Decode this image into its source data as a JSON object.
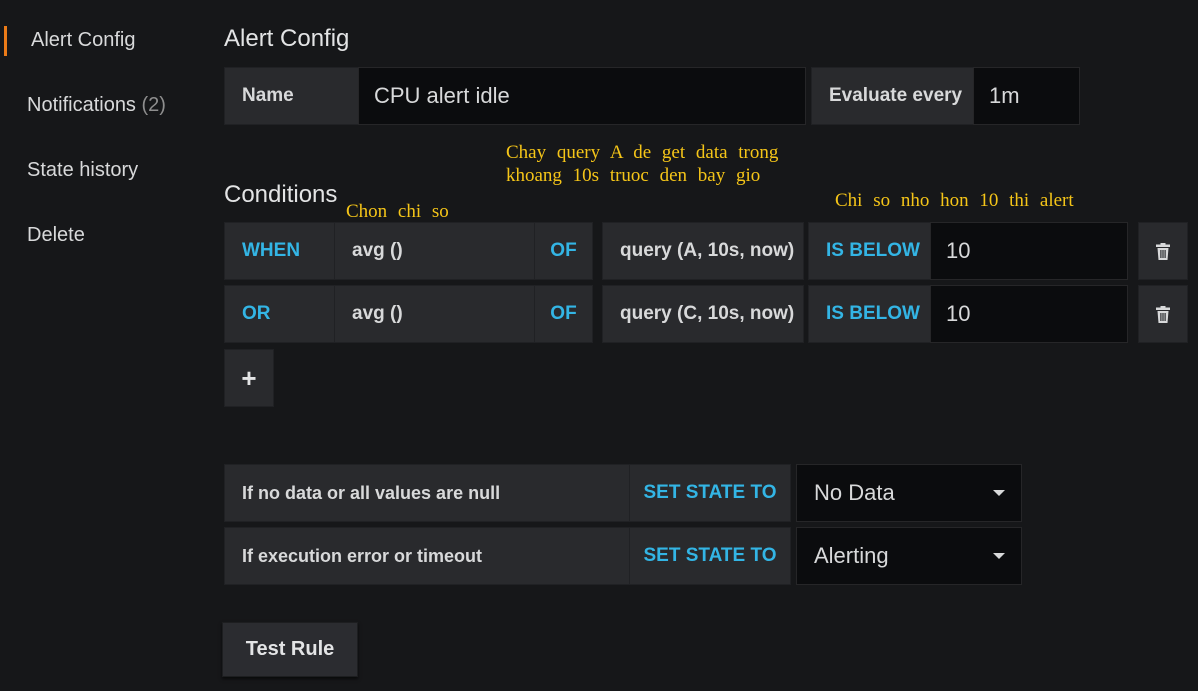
{
  "sidebar": {
    "items": [
      {
        "label": "Alert Config"
      },
      {
        "label": "Notifications",
        "count": "(2)"
      },
      {
        "label": "State history"
      },
      {
        "label": "Delete"
      }
    ]
  },
  "alert_config": {
    "title": "Alert Config",
    "name_label": "Name",
    "name_value": "CPU alert idle",
    "evaluate_label": "Evaluate every",
    "evaluate_value": "1m"
  },
  "conditions": {
    "title": "Conditions",
    "rows": [
      {
        "operator": "WHEN",
        "reducer": "avg ()",
        "of": "OF",
        "query": "query (A, 10s, now)",
        "evaluator": "IS BELOW",
        "threshold": "10"
      },
      {
        "operator": "OR",
        "reducer": "avg ()",
        "of": "OF",
        "query": "query (C, 10s, now)",
        "evaluator": "IS BELOW",
        "threshold": "10"
      }
    ],
    "add_label": "+"
  },
  "annotations": {
    "query_note_line1": "Chay query A de get data trong",
    "query_note_line2": "khoang 10s truoc den bay gio",
    "reducer_note": "Chon chi so",
    "threshold_note": "Chi so nho hon 10 thi alert"
  },
  "no_data": {
    "no_data_label": "If no data or all values are null",
    "no_data_set": "SET STATE TO",
    "no_data_value": "No Data",
    "error_label": "If execution error or timeout",
    "error_set": "SET STATE TO",
    "error_value": "Alerting"
  },
  "test_rule_label": "Test Rule",
  "colors": {
    "background": "#161719",
    "keyword": "#33b5e5",
    "active_accent": "#eb7b18",
    "annotation": "#f5c518"
  }
}
